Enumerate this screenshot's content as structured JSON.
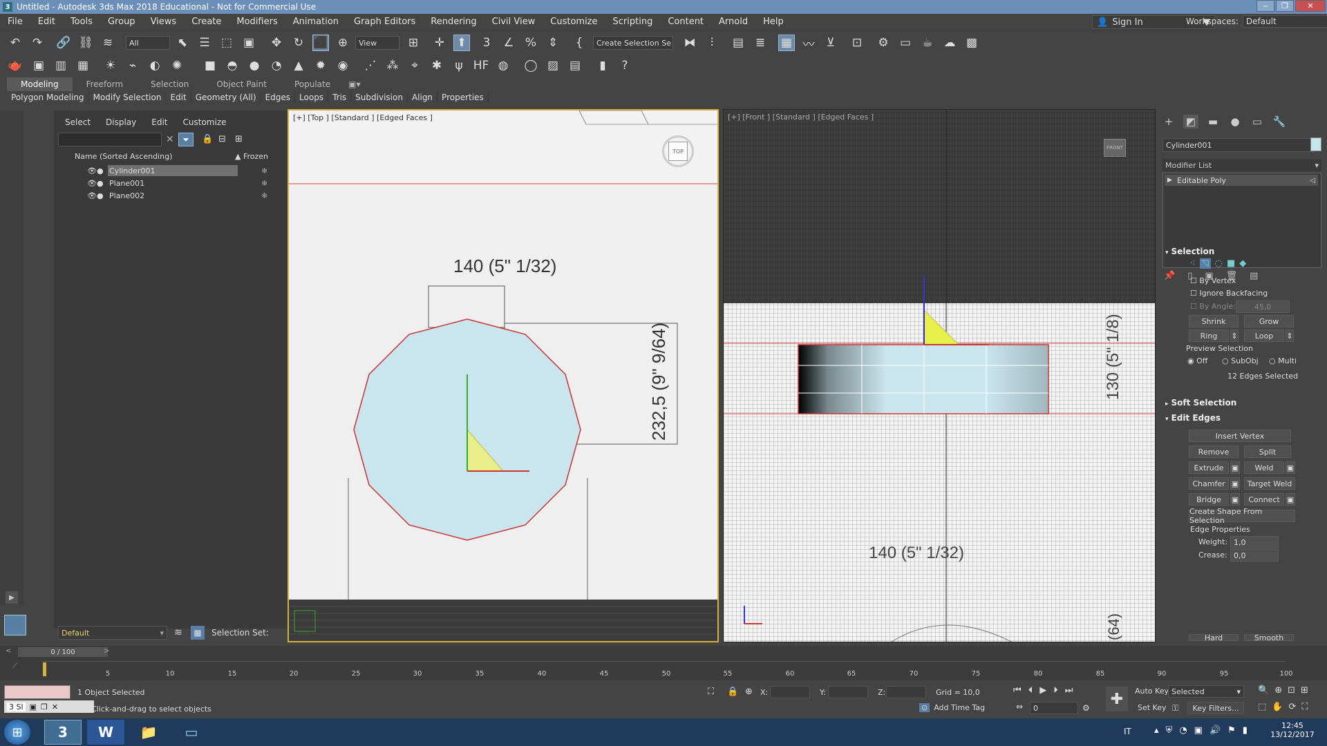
{
  "title": "Untitled - Autodesk 3ds Max 2018 Educational - Not for Commercial Use",
  "app_icon_text": "3",
  "menu": [
    "File",
    "Edit",
    "Tools",
    "Group",
    "Views",
    "Create",
    "Modifiers",
    "Animation",
    "Graph Editors",
    "Rendering",
    "Civil View",
    "Customize",
    "Scripting",
    "Content",
    "Arnold",
    "Help"
  ],
  "signin": "Sign In",
  "workspaces_label": "Workspaces:",
  "workspaces_value": "Default",
  "toolbar": {
    "filter_value": "All",
    "view_value": "View",
    "selection_set_value": "Create Selection Se"
  },
  "ribbon": {
    "tabs": [
      "Modeling",
      "Freeform",
      "Selection",
      "Object Paint",
      "Populate"
    ],
    "buttons": [
      "Polygon Modeling",
      "Modify Selection",
      "Edit",
      "Geometry (All)",
      "Edges",
      "Loops",
      "Tris",
      "Subdivision",
      "Align",
      "Properties"
    ]
  },
  "scene_explorer": {
    "menus": [
      "Select",
      "Display",
      "Edit",
      "Customize"
    ],
    "col_name": "Name (Sorted Ascending)",
    "col_frozen": "▲ Frozen",
    "objects": [
      "Cylinder001",
      "Plane001",
      "Plane002"
    ],
    "layer_value": "Default",
    "selection_set_label": "Selection Set:"
  },
  "viewport_top": {
    "label": "[+] [Top ] [Standard ] [Edged Faces ]",
    "viewcube": "TOP",
    "dim_width": "140 (5\" 1/32)",
    "dim_height": "232,5 (9\" 9/64)"
  },
  "viewport_front": {
    "label": "[+] [Front ] [Standard ] [Edged Faces ]",
    "viewcube": "FRONT",
    "dim_width": "140 (5\" 1/32)",
    "dim_side": "130 (5\" 1/8)",
    "dim_bottom": "(64)"
  },
  "command_panel": {
    "object_name": "Cylinder001",
    "modifier_list": "Modifier List",
    "modifier": "Editable Poly",
    "selection": {
      "title": "Selection",
      "by_vertex": "By Vertex",
      "ignore_backfacing": "Ignore Backfacing",
      "by_angle": "By Angle:",
      "by_angle_value": "45,0",
      "shrink": "Shrink",
      "grow": "Grow",
      "ring": "Ring",
      "loop": "Loop",
      "preview_selection": "Preview Selection",
      "off": "Off",
      "subobj": "SubObj",
      "multi": "Multi",
      "status": "12 Edges Selected"
    },
    "soft_selection": "Soft Selection",
    "edit_edges": {
      "title": "Edit Edges",
      "insert_vertex": "Insert Vertex",
      "remove": "Remove",
      "split": "Split",
      "extrude": "Extrude",
      "weld": "Weld",
      "chamfer": "Chamfer",
      "target_weld": "Target Weld",
      "bridge": "Bridge",
      "connect": "Connect",
      "create_shape": "Create Shape From Selection",
      "edge_properties": "Edge Properties",
      "weight_label": "Weight:",
      "weight_value": "1,0",
      "crease_label": "Crease:",
      "crease_value": "0,0",
      "hard": "Hard",
      "smooth": "Smooth"
    }
  },
  "timeline": {
    "frame": "0 / 100",
    "ticks": [
      "5",
      "10",
      "15",
      "20",
      "25",
      "30",
      "35",
      "40",
      "45",
      "50",
      "55",
      "60",
      "65",
      "70",
      "75",
      "80",
      "85",
      "90",
      "95",
      "100"
    ]
  },
  "status": {
    "selected": "1 Object Selected",
    "prompt": "Click-and-drag to select objects",
    "x_label": "X:",
    "y_label": "Y:",
    "z_label": "Z:",
    "grid": "Grid = 10,0",
    "add_time_tag": "Add Time Tag",
    "auto_key": "Auto Key",
    "set_key": "Set Key",
    "key_mode": "Selected",
    "key_filters": "Key Filters...",
    "frame_value": "0",
    "listener_tab": "Sl"
  },
  "taskbar": {
    "lang": "IT",
    "time": "12:45",
    "date": "13/12/2017"
  }
}
